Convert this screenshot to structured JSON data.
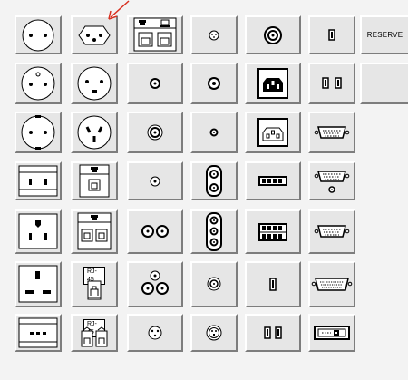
{
  "palette": {
    "reserve_label": "RESERVE",
    "rj45_label": "RJ-45",
    "pointer_color": "#d83020"
  }
}
